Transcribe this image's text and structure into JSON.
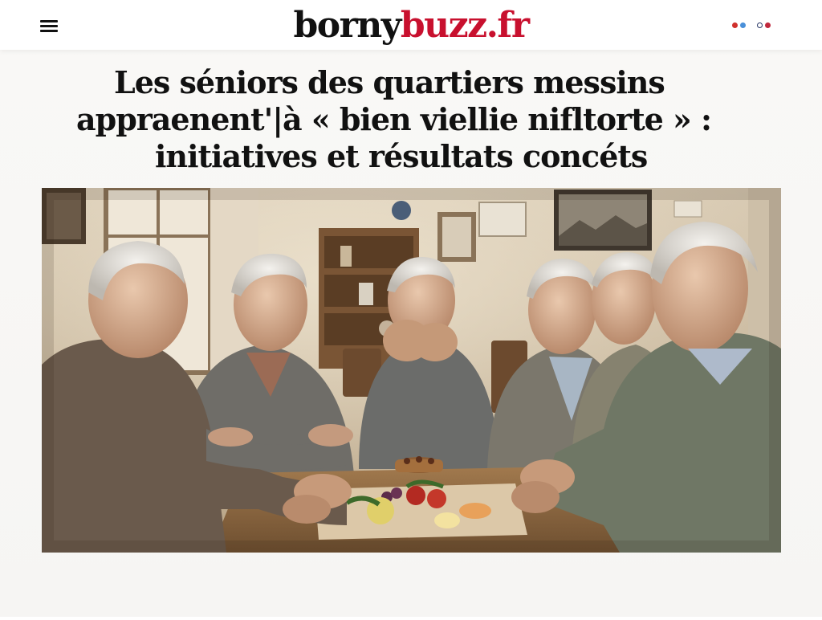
{
  "header": {
    "site_name_part1": "borny",
    "site_name_part2": "buzz.fr",
    "brand_color_dark": "#111111",
    "brand_color_red": "#c8102e",
    "menu_icon": "hamburger-menu-icon",
    "share_icons": [
      "share-icon-red",
      "share-icon-blue",
      "share-icon-navy",
      "share-icon-red-2"
    ]
  },
  "article": {
    "headline_line1": "Les séniors des quartiers messins",
    "headline_line2": "appraenent'|à « bien viellie nifltorte » :",
    "headline_line3": "initiatives et résultats concéts"
  },
  "colors": {
    "accent_red": "#c8102e",
    "accent_blue": "#4a90d9",
    "accent_navy": "#2b3a67"
  }
}
